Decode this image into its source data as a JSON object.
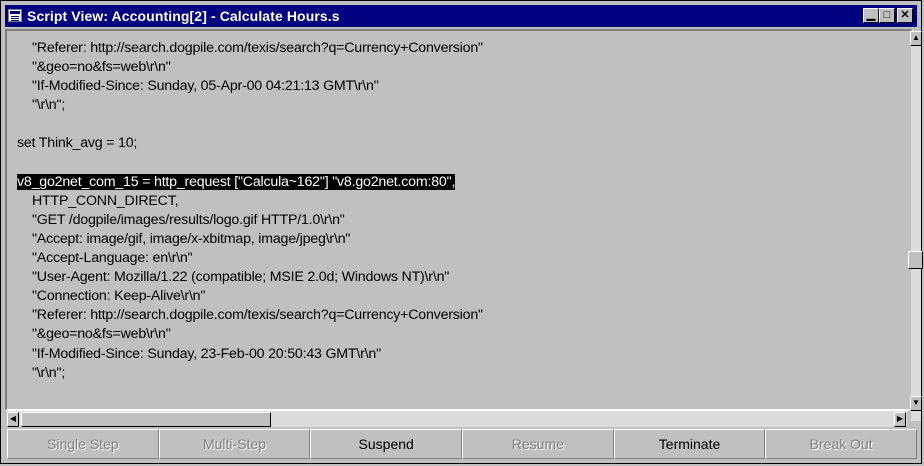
{
  "window": {
    "title": "Script View: Accounting[2] - Calculate Hours.s",
    "minimize_glyph": "▁",
    "maximize_glyph": "□",
    "close_glyph": "✕"
  },
  "code_lines": [
    "    \"Referer: http://search.dogpile.com/texis/search?q=Currency+Conversion\"",
    "    \"&geo=no&fs=web\\r\\n\"",
    "    \"If-Modified-Since: Sunday, 05-Apr-00 04:21:13 GMT\\r\\n\"",
    "    \"\\r\\n\";",
    "",
    "set Think_avg = 10;",
    "",
    "v8_go2net_com_15 = http_request [\"Calcula~162\"] \"v8.go2net.com:80\",",
    "    HTTP_CONN_DIRECT,",
    "    \"GET /dogpile/images/results/logo.gif HTTP/1.0\\r\\n\"",
    "    \"Accept: image/gif, image/x-xbitmap, image/jpeg\\r\\n\"",
    "    \"Accept-Language: en\\r\\n\"",
    "    \"User-Agent: Mozilla/1.22 (compatible; MSIE 2.0d; Windows NT)\\r\\n\"",
    "    \"Connection: Keep-Alive\\r\\n\"",
    "    \"Referer: http://search.dogpile.com/texis/search?q=Currency+Conversion\"",
    "    \"&geo=no&fs=web\\r\\n\"",
    "    \"If-Modified-Since: Sunday, 23-Feb-00 20:50:43 GMT\\r\\n\"",
    "    \"\\r\\n\";"
  ],
  "highlighted_line_index": 7,
  "scrollbar": {
    "up_glyph": "▲",
    "down_glyph": "▼",
    "left_glyph": "◀",
    "right_glyph": "▶"
  },
  "toolbar": {
    "single_step": "Single Step",
    "multi_step": "Multi-Step",
    "suspend": "Suspend",
    "resume": "Resume",
    "terminate": "Terminate",
    "break_out": "Break Out"
  }
}
